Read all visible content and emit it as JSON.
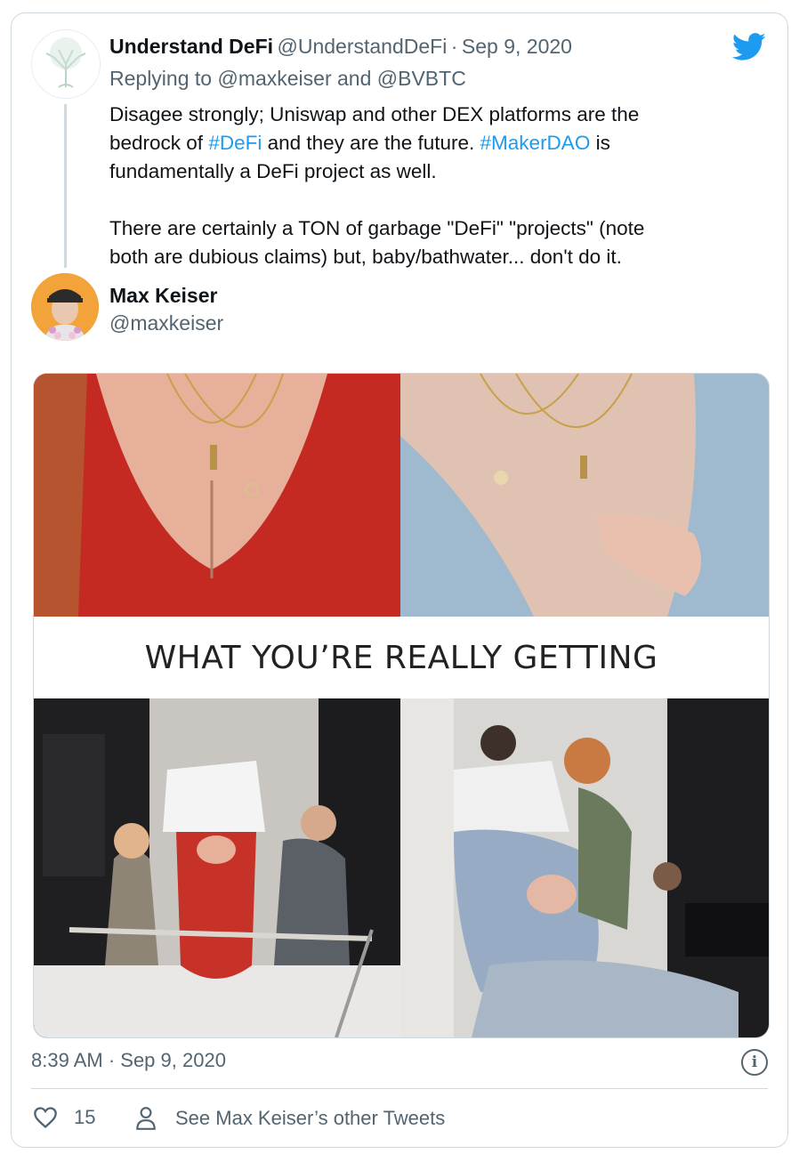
{
  "tweet1": {
    "author_name": "Understand DeFi",
    "author_handle": "@UnderstandDeFi",
    "separator": "·",
    "date": "Sep 9, 2020",
    "reply_prefix": "Replying to",
    "reply_to_1": "@maxkeiser",
    "reply_and": "and",
    "reply_to_2": "@BVBTC",
    "text_1": "Disagee strongly; Uniswap and other DEX platforms are the\nbedrock of ",
    "hashtag_1": "#DeFi",
    "text_2": " and they are the future. ",
    "hashtag_2": "#MakerDAO",
    "text_3": " is\nfundamentally a DeFi project as well.\n\nThere are certainly a TON of garbage \"DeFi\" \"projects\" (note\nboth are dubious claims) but, baby/bathwater... don't do it."
  },
  "tweet2": {
    "author_name": "Max Keiser",
    "author_handle": "@maxkeiser",
    "image_caption": "WHAT YOU’RE REALLY GETTING",
    "timestamp": "8:39 AM · Sep 9, 2020",
    "like_count": "15",
    "see_other": "See Max Keiser’s other Tweets"
  },
  "icons": {
    "twitter": "twitter-bird-icon",
    "info": "info-icon",
    "like": "heart-icon",
    "profile": "person-icon"
  },
  "colors": {
    "link": "#1d9bf0",
    "muted": "#536471",
    "twitter_blue": "#1d9bf0"
  }
}
